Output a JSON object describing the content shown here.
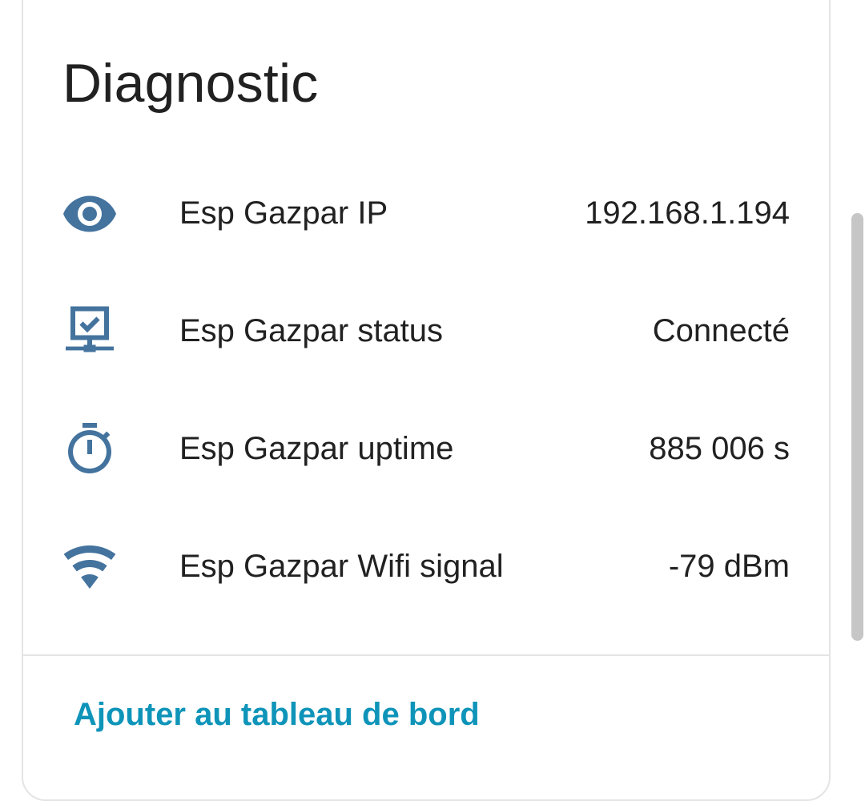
{
  "card": {
    "title": "Diagnostic"
  },
  "rows": [
    {
      "icon": "eye-icon",
      "label": "Esp Gazpar IP",
      "value": "192.168.1.194"
    },
    {
      "icon": "network-check-icon",
      "label": "Esp Gazpar status",
      "value": "Connecté"
    },
    {
      "icon": "timer-icon",
      "label": "Esp Gazpar uptime",
      "value": "885 006 s"
    },
    {
      "icon": "wifi-icon",
      "label": "Esp Gazpar Wifi signal",
      "value": "-79 dBm"
    }
  ],
  "footer": {
    "action_label": "Ajouter au tableau de bord"
  },
  "colors": {
    "icon": "#44739e",
    "text": "#212121",
    "link": "#0f94b9",
    "border": "#e4e4e4"
  }
}
